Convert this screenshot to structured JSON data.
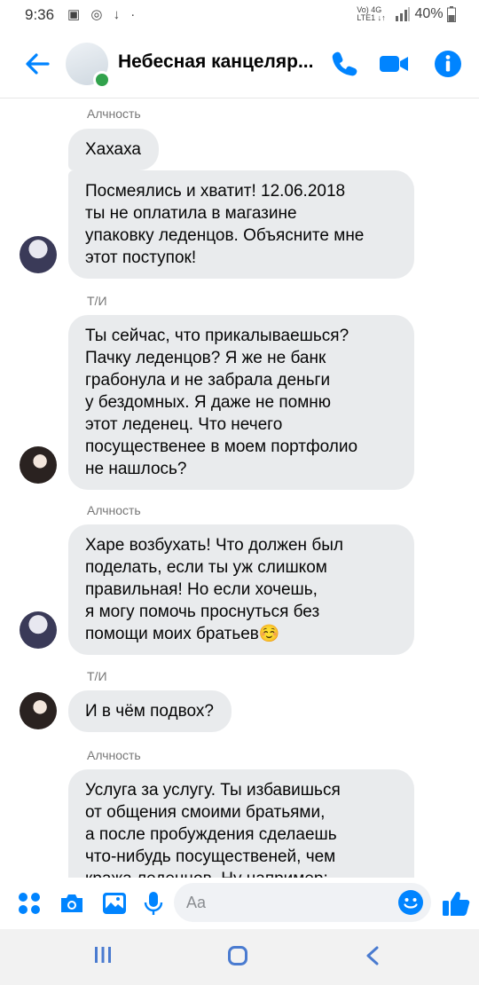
{
  "status_bar": {
    "time": "9:36",
    "left_icons": "▣ ◎ ↓ ·",
    "network": "Vo) 4G\nLTE1 ↓↑",
    "battery": "40%"
  },
  "header": {
    "title": "Небесная канцеляр...",
    "back_icon": "back-arrow-icon",
    "actions": [
      "phone-icon",
      "video-icon",
      "info-icon"
    ]
  },
  "messages": [
    {
      "sender": "Алчность",
      "bubbles": [
        "Хахаха",
        "Посмеялись и хватит! 12.06.2018\nты не оплатила в магазине\nупаковку леденцов. Объясните мне\nэтот поступок!"
      ]
    },
    {
      "sender": "Т/И",
      "bubbles": [
        "Ты сейчас, что прикалываешься?\nПачку леденцов? Я же не банк\nграбонула и не забрала деньги\nу бездомных. Я даже не помню\nэтот леденец. Что нечего\nпосущественее в моем портфолио\nне нашлось?"
      ]
    },
    {
      "sender": "Алчность",
      "bubbles": [
        "Харе возбухать! Что должен был\nподелать, если ты уж слишком\nправильная! Но если хочешь,\nя могу помочь проснуться без\nпомощи моих братьев☺️"
      ]
    },
    {
      "sender": "Т/И",
      "bubbles": [
        "И в чём подвох?"
      ]
    },
    {
      "sender": "Алчность",
      "bubbles": [
        "Услуга за услугу. Ты избавишься\nот общения смоими братьями,\nа после пробуждения сделаешь\nчто-нибудь посущественей, чем\nкража леденцов. Ну например:"
      ]
    }
  ],
  "composer": {
    "placeholder": "Aa"
  },
  "colors": {
    "accent": "#0084ff",
    "bubble": "#e9ebed",
    "online": "#31a24c"
  }
}
